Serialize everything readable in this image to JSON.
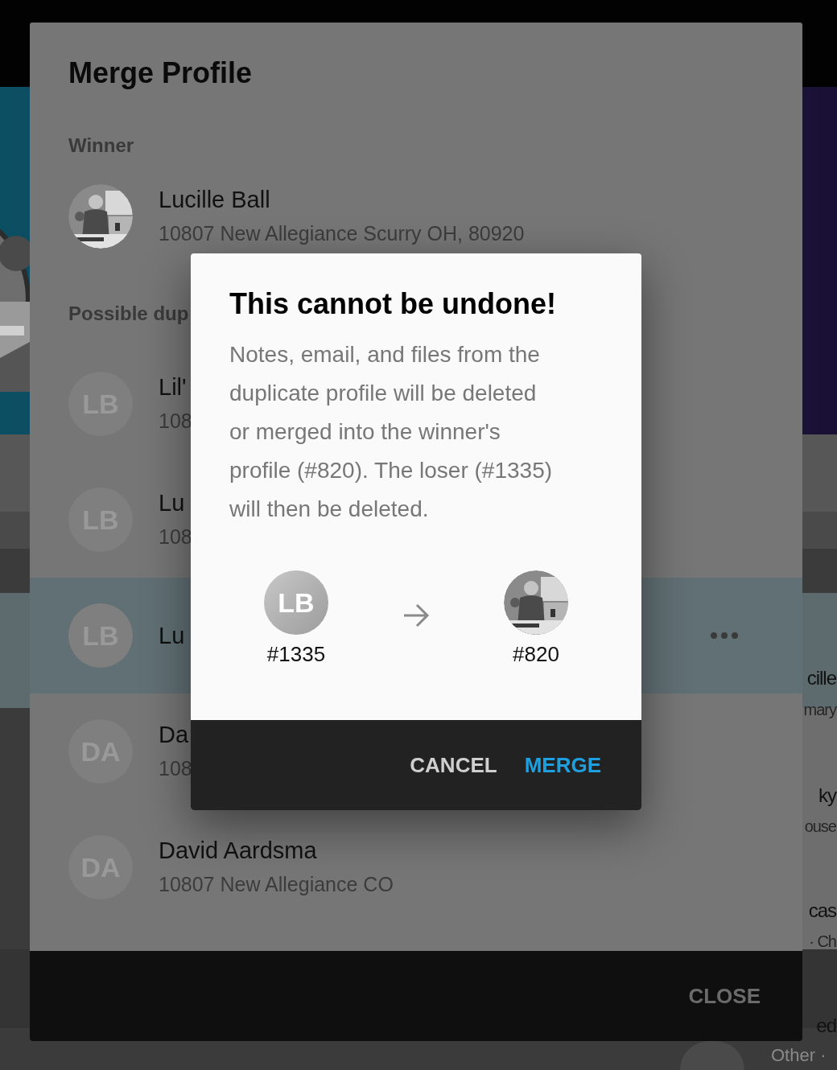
{
  "background": {
    "list": [
      {
        "name": "cille",
        "detail": "mary"
      },
      {
        "name": "ky",
        "detail": "ouse"
      },
      {
        "name": "cas",
        "detail": "· Ch"
      },
      {
        "name": "ed",
        "detail": "Other ·",
        "kind": "avatar_row"
      }
    ]
  },
  "merge_dialog": {
    "title": "Merge Profile",
    "winner": {
      "label": "Winner",
      "name": "Lucille Ball",
      "address": "10807 New Allegiance Scurry OH, 80920"
    },
    "duplicates": {
      "label": "Possible dup",
      "rows": [
        {
          "initials": "LB",
          "name": "Lil'",
          "address": "108",
          "selected": false
        },
        {
          "initials": "LB",
          "name": "Lu",
          "address": "108",
          "selected": false
        },
        {
          "initials": "LB",
          "name": "Lu",
          "selected": true
        },
        {
          "initials": "DA",
          "name": "Da",
          "address": "108",
          "selected": false
        },
        {
          "initials": "DA",
          "name": "David Aardsma",
          "address": "10807 New Allegiance CO",
          "selected": false
        }
      ]
    },
    "close": "CLOSE"
  },
  "confirm_dialog": {
    "title": "This cannot be undone!",
    "message": "Notes, email, and files from the duplicate profile will be deleted or merged into the winner's profile (#820). The loser (#1335) will then be deleted.",
    "from": {
      "initials": "LB",
      "id": "#1335"
    },
    "to": {
      "id": "#820"
    },
    "buttons": [
      {
        "label": "CANCEL",
        "kind": "secondary"
      },
      {
        "label": "MERGE",
        "kind": "primary"
      }
    ]
  }
}
